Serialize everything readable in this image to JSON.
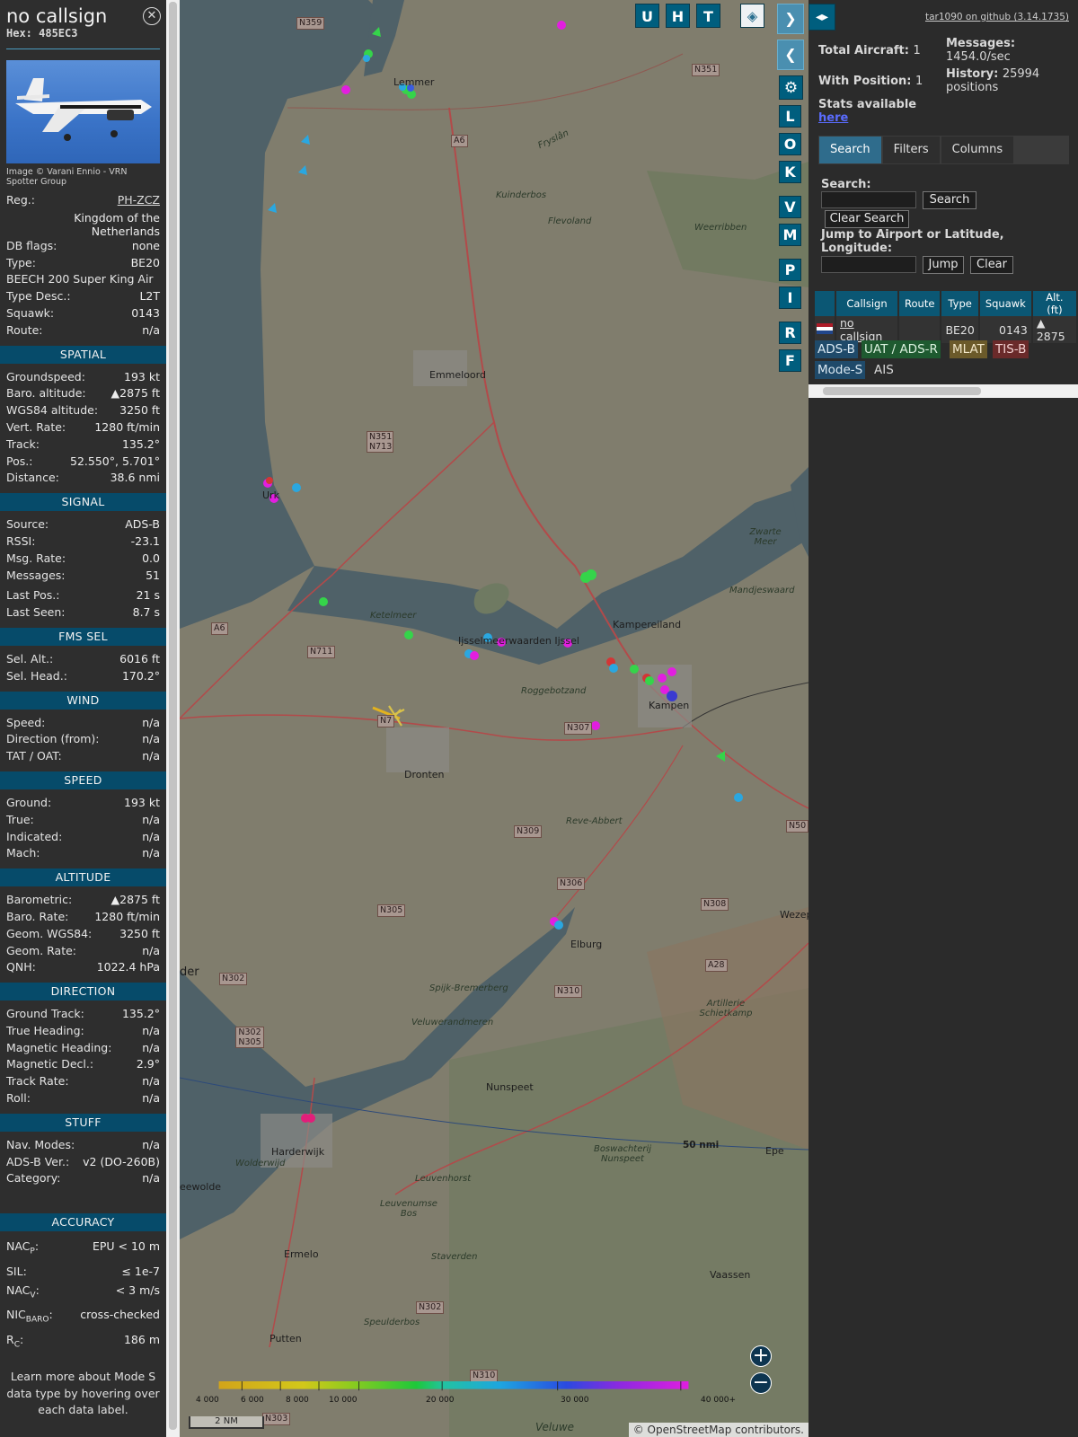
{
  "detail": {
    "callsign": "no callsign",
    "hex": "Hex: 485EC3",
    "photo_credit": "Image © Varani Ennio - VRN Spotter Group",
    "info": [
      {
        "k": "Reg.:",
        "v": "PH-ZCZ",
        "link": true
      },
      {
        "k": "",
        "v": "Kingdom of the Netherlands",
        "wrap": true
      },
      {
        "k": "DB flags:",
        "v": "none"
      },
      {
        "k": "Type:",
        "v": "BE20"
      },
      {
        "k": "BEECH 200 Super King Air",
        "v": ""
      },
      {
        "k": "Type Desc.:",
        "v": "L2T"
      },
      {
        "k": "Squawk:",
        "v": "0143"
      },
      {
        "k": "Route:",
        "v": "n/a"
      }
    ],
    "sections": [
      {
        "title": "SPATIAL",
        "rows": [
          {
            "k": "Groundspeed:",
            "v": "193 kt"
          },
          {
            "k": "Baro. altitude:",
            "v": "▲2875 ft"
          },
          {
            "k": "WGS84 altitude:",
            "v": "3250 ft"
          },
          {
            "k": "Vert. Rate:",
            "v": "1280 ft/min"
          },
          {
            "k": "Track:",
            "v": "135.2°"
          },
          {
            "k": "Pos.:",
            "v": "52.550°, 5.701°"
          },
          {
            "k": "Distance:",
            "v": "38.6 nmi"
          }
        ]
      },
      {
        "title": "SIGNAL",
        "rows": [
          {
            "k": "Source:",
            "v": "ADS-B"
          },
          {
            "k": "RSSI:",
            "v": "-23.1"
          },
          {
            "k": "Msg. Rate:",
            "v": "0.0"
          },
          {
            "k": "Messages:",
            "v": "51"
          },
          {
            "k": "",
            "v": ""
          },
          {
            "k": "Last Pos.:",
            "v": "21 s"
          },
          {
            "k": "Last Seen:",
            "v": "8.7 s"
          }
        ]
      },
      {
        "title": "FMS SEL",
        "rows": [
          {
            "k": "Sel. Alt.:",
            "v": "6016 ft"
          },
          {
            "k": "Sel. Head.:",
            "v": "170.2°"
          }
        ]
      },
      {
        "title": "WIND",
        "rows": [
          {
            "k": "Speed:",
            "v": "n/a"
          },
          {
            "k": "Direction (from):",
            "v": "n/a"
          },
          {
            "k": "TAT / OAT:",
            "v": "n/a"
          }
        ]
      },
      {
        "title": "SPEED",
        "rows": [
          {
            "k": "Ground:",
            "v": "193 kt"
          },
          {
            "k": "True:",
            "v": "n/a"
          },
          {
            "k": "Indicated:",
            "v": "n/a"
          },
          {
            "k": "Mach:",
            "v": "n/a"
          }
        ]
      },
      {
        "title": "ALTITUDE",
        "rows": [
          {
            "k": "Barometric:",
            "v": "▲2875 ft"
          },
          {
            "k": "Baro. Rate:",
            "v": "1280 ft/min"
          },
          {
            "k": "Geom. WGS84:",
            "v": "3250 ft"
          },
          {
            "k": "Geom. Rate:",
            "v": "n/a"
          },
          {
            "k": "QNH:",
            "v": "1022.4 hPa"
          }
        ]
      },
      {
        "title": "DIRECTION",
        "rows": [
          {
            "k": "Ground Track:",
            "v": "135.2°"
          },
          {
            "k": "True Heading:",
            "v": "n/a"
          },
          {
            "k": "Magnetic Heading:",
            "v": "n/a"
          },
          {
            "k": "Magnetic Decl.:",
            "v": "2.9°"
          },
          {
            "k": "Track Rate:",
            "v": "n/a"
          },
          {
            "k": "Roll:",
            "v": "n/a"
          }
        ]
      },
      {
        "title": "STUFF",
        "rows": [
          {
            "k": "Nav. Modes:",
            "v": "n/a"
          },
          {
            "k": "ADS-B Ver.:",
            "v": "v2 (DO-260B)"
          },
          {
            "k": "Category:",
            "v": "n/a"
          }
        ]
      }
    ],
    "accuracy_title": "ACCURACY",
    "accuracy": [
      {
        "k": "NAC",
        "sub": "P",
        "v": "EPU < 10 m"
      },
      {
        "k": "SIL:",
        "sub": "",
        "v": "≤ 1e-7"
      },
      {
        "k": "NAC",
        "sub": "V",
        "v": "< 3 m/s"
      },
      {
        "k": "NIC",
        "sub": "BARO",
        "v": "cross-checked"
      },
      {
        "k": "R",
        "sub": "C",
        "v": "186 m"
      }
    ],
    "note": "Learn more about Mode S data type by hovering over each data label."
  },
  "map": {
    "buttons_top": [
      "U",
      "H",
      "T"
    ],
    "buttons_side": [
      "L",
      "O",
      "K",
      "V",
      "M",
      "P",
      "I",
      "R",
      "F"
    ],
    "places": [
      "Lemmer",
      "Emmeloord",
      "Urk",
      "Dronten",
      "Kampen",
      "Elburg",
      "Nunspeet",
      "Harderwijk",
      "Ermelo",
      "Putten",
      "Vaassen",
      "Epe",
      "Wezep",
      "Kampereiland",
      "Zwarte Meer",
      "Mandjeswaard",
      "Ketelmeer",
      "Weerribben",
      "Kuinderbos",
      "Flevoland",
      "Fryslân",
      "Roggebotzand",
      "Reve-Abbert",
      "Spijk-Bremerberg",
      "Veluwerandmeren",
      "Artillerie Schietkamp",
      "Leuvenhorst",
      "Leuvenumse Bos",
      "Staverden",
      "Speulderbos",
      "Veluwe",
      "Boswachterij Nunspeet",
      "Wolderwijd",
      "Ijsselmeerwaarden Ijssel",
      "eewolde",
      "der"
    ],
    "roads": [
      "N359",
      "N351",
      "A6",
      "N351 N713",
      "N711",
      "A6",
      "N307",
      "N309",
      "N306",
      "N305",
      "N302",
      "N302 N305",
      "N310",
      "N308",
      "A28",
      "N50",
      "N302",
      "N310",
      "N303",
      "N7"
    ],
    "range_ring": "50 nmi",
    "alt_scale": [
      "4 000",
      "6 000",
      "8 000",
      "10 000",
      "20 000",
      "30 000",
      "40 000+"
    ],
    "scale": "2 NM",
    "attribution": "© OpenStreetMap contributors."
  },
  "right": {
    "github": "tar1090 on github (3.14.1735)",
    "total_aircraft_label": "Total Aircraft:",
    "total_aircraft": "1",
    "with_position_label": "With Position:",
    "with_position": "1",
    "messages_label": "Messages:",
    "messages": "1454.0/sec",
    "history_label": "History:",
    "history": "25994 positions",
    "stats_label": "Stats available",
    "stats_link": "here",
    "tabs": [
      "Search",
      "Filters",
      "Columns"
    ],
    "search_label": "Search:",
    "search_button": "Search",
    "clear_search_button": "Clear Search",
    "jump_label": "Jump to Airport or Latitude, Longitude:",
    "jump_button": "Jump",
    "clear_button": "Clear",
    "table_headers": [
      "Callsign",
      "Route",
      "Type",
      "Squawk",
      "Alt. (ft)"
    ],
    "table_rows": [
      {
        "callsign": "no callsign",
        "route": "",
        "type": "BE20",
        "squawk": "0143",
        "alt": "▲ 2875"
      }
    ],
    "source_chips": [
      "ADS-B",
      "UAT / ADS-R",
      "MLAT",
      "TIS-B",
      "Mode-S",
      "AIS"
    ],
    "colors": {
      "accent": "#005e7e",
      "adsb": "#1f4a6a",
      "uat": "#1e5a30",
      "mlat": "#6b5a2a",
      "tisb": "#6a2a2a"
    }
  }
}
